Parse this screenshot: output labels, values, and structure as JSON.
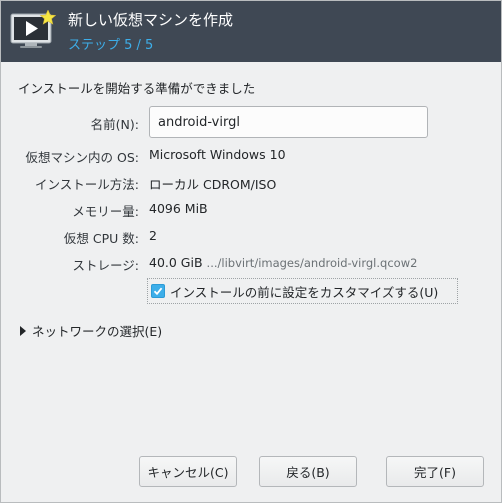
{
  "header": {
    "title": "新しい仮想マシンを作成",
    "step": "ステップ 5 / 5",
    "icon": "new-vm-monitor-icon"
  },
  "ready_message": "インストールを開始する準備ができました",
  "fields": {
    "name": {
      "label": "名前(N):",
      "value": "android-virgl"
    },
    "os": {
      "label": "仮想マシン内の OS:",
      "value": "Microsoft Windows 10"
    },
    "install_method": {
      "label": "インストール方法:",
      "value": "ローカル CDROM/ISO"
    },
    "memory": {
      "label": "メモリー量:",
      "value": "4096 MiB"
    },
    "cpu": {
      "label": "仮想 CPU 数:",
      "value": "2"
    },
    "storage": {
      "label": "ストレージ:",
      "size": "40.0 GiB",
      "path": ".../libvirt/images/android-virgl.qcow2"
    }
  },
  "customize": {
    "label": "インストールの前に設定をカスタマイズする(U)",
    "checked": true
  },
  "network": {
    "label": "ネットワークの選択(E)",
    "expanded": false
  },
  "buttons": {
    "cancel": "キャンセル(C)",
    "back": "戻る(B)",
    "finish": "完了(F)"
  },
  "colors": {
    "header_bg": "#3f4854",
    "accent": "#3daee9",
    "window_bg": "#eff0f1"
  }
}
